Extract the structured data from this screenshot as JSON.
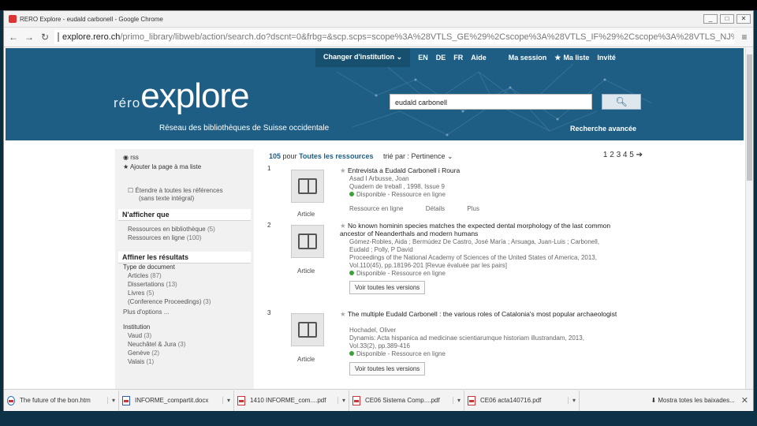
{
  "window": {
    "title": "RERO Explore - eudald carbonell - Google Chrome"
  },
  "address": {
    "host": "explore.rero.ch",
    "path": "/primo_library/libweb/action/search.do?dscnt=0&frbg=&scp.scps=scope%3A%28VTLS_GE%29%2Cscope%3A%28VTLS_IF%29%2Cscope%3A%28VTLS_NJ%"
  },
  "nav": {
    "institution": "Changer d'institution",
    "lang_en": "EN",
    "lang_de": "DE",
    "lang_fr": "FR",
    "help": "Aide",
    "session": "Ma session",
    "list": "Ma liste",
    "guest": "Invité"
  },
  "header": {
    "logo_rero": "réro",
    "logo_explore": "explore",
    "tagline": "Réseau des bibliothèques de Suisse occidentale",
    "search_value": "eudald carbonell",
    "advanced": "Recherche avancée"
  },
  "facets": {
    "rss": "rss",
    "add_page": "Ajouter la page à ma liste",
    "extend": "Étendre à toutes les références",
    "extend2": "(sans texte intégral)",
    "show_only": "N'afficher que",
    "library": "Ressources en bibliothèque",
    "library_count": "(5)",
    "online": "Ressources en ligne",
    "online_count": "(100)",
    "refine": "Affiner les résultats",
    "doctype": "Type de document",
    "articles": "Articles",
    "articles_count": "(87)",
    "dissertations": "Dissertations",
    "dissertations_count": "(13)",
    "books": "Livres",
    "books_count": "(5)",
    "conference": "(Conference Proceedings)",
    "conference_count": "(3)",
    "more_options": "Plus d'options ...",
    "institution": "Institution",
    "vaud": "Vaud",
    "vaud_count": "(3)",
    "neuchatel": "Neuchâtel & Jura",
    "neuchatel_count": "(3)",
    "geneve": "Genève",
    "geneve_count": "(2)",
    "valais": "Valais",
    "valais_count": "(1)"
  },
  "results": {
    "count": "105",
    "for_label": "pour",
    "scope": "Toutes les ressources",
    "sort_label": "trié par :",
    "sort_value": "Pertinence",
    "pager": "1 2 3 4 5",
    "items": [
      {
        "num": "1",
        "type": "Article",
        "title": "Entrevista a Eudald Carbonell i Roura",
        "author": "Asad I Arbusse, Joan",
        "source": "Quadern de treball , 1998, Issue 9",
        "availability": "Disponible - Ressource en ligne",
        "action1": "Ressource en ligne",
        "action2": "Détails",
        "action3": "Plus"
      },
      {
        "num": "2",
        "type": "Article",
        "title": "No known hominin species matches the expected dental morphology of the last common ancestor of Neanderthals and modern humans",
        "author1": "Gómez-Robles, Aida ; Bermúdez De Castro, José María ; Arsuaga, Juan-Luis ; Carbonell,",
        "author2": "Eudald ; Polly, P David",
        "source1": "Proceedings of the National Academy of Sciences of the United States of America, 2013,",
        "source2": "Vol.110(45), pp.18196-201 [Revue évaluée par les pairs]",
        "availability": "Disponible - Ressource en ligne",
        "versions": "Voir toutes les versions"
      },
      {
        "num": "3",
        "type": "Article",
        "title": "The multiple Eudald Carbonell : the various roles of Catalonia's most popular archaeologist",
        "author": "Hochadel, Oliver",
        "source1": "Dynamis: Acta hispanica ad medicinae scientiarumque historiam illustrandam, 2013,",
        "source2": "Vol.33(2), pp.389-416",
        "availability": "Disponible - Ressource en ligne",
        "versions": "Voir toutes les versions"
      }
    ]
  },
  "downloads": {
    "items": [
      {
        "name": "The future of the bon.htm"
      },
      {
        "name": "INFORME_compartit.docx"
      },
      {
        "name": "1410 INFORME_com....pdf"
      },
      {
        "name": "CE06 Sistema Comp....pdf"
      },
      {
        "name": "CE06 acta140716.pdf"
      }
    ],
    "show_all": "Mostra totes les baixades..."
  },
  "colors": {
    "banner": "#1e5e85",
    "available": "#3aa23a"
  }
}
